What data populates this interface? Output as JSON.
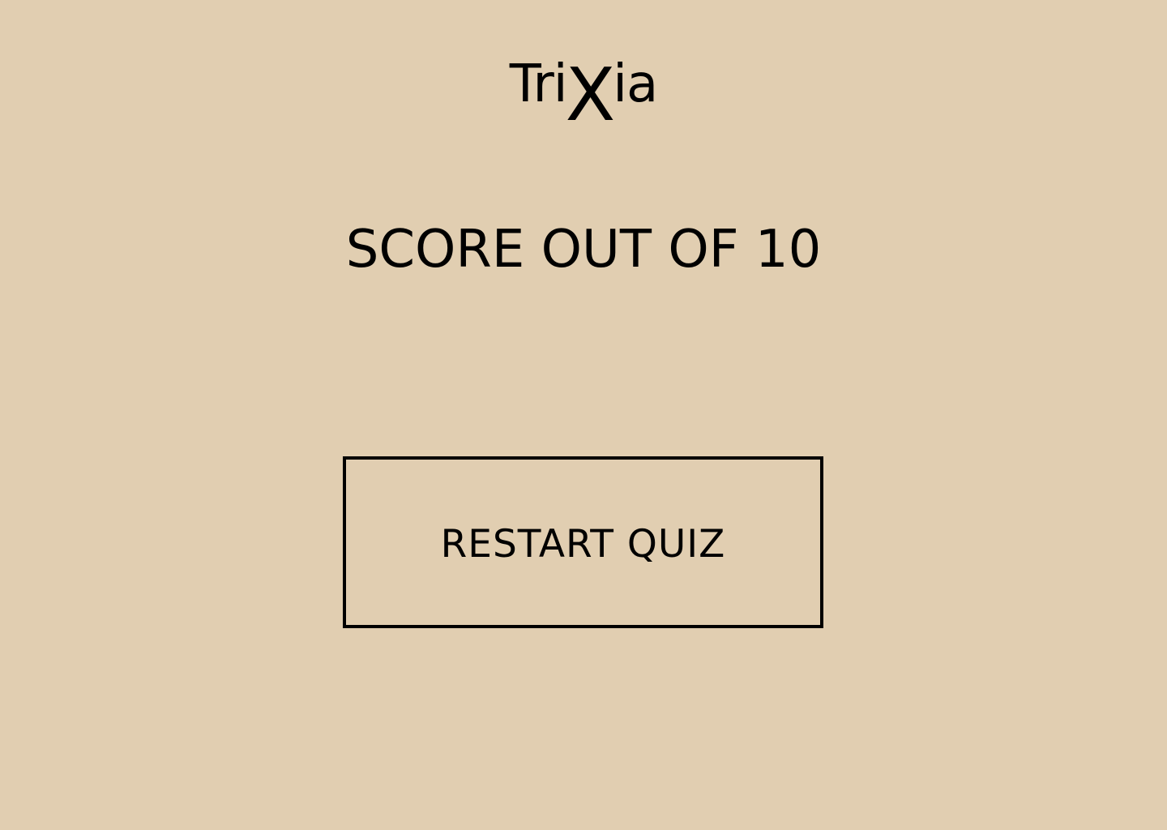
{
  "logo": {
    "prefix": "Tri",
    "highlight": "X",
    "suffix": "ia"
  },
  "result": {
    "title": "SCORE OUT OF 10"
  },
  "actions": {
    "restart_label": "RESTART QUIZ"
  },
  "colors": {
    "background": "#e1ceb1",
    "text": "#000000",
    "button_border": "#000000"
  }
}
